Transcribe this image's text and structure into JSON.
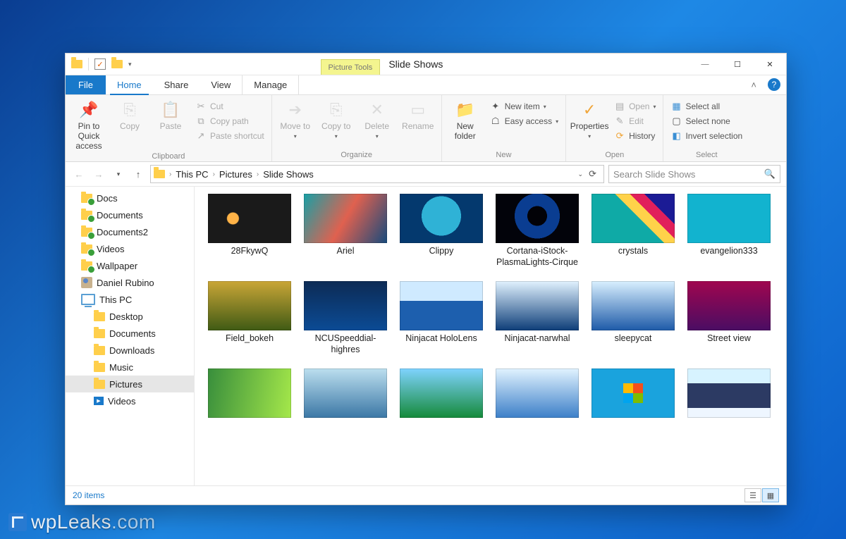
{
  "titlebar": {
    "context_tab": "Picture Tools",
    "title": "Slide Shows",
    "min": "—",
    "max": "☐",
    "close": "✕"
  },
  "tabs": {
    "file": "File",
    "home": "Home",
    "share": "Share",
    "view": "View",
    "manage": "Manage"
  },
  "ribbon": {
    "clipboard": {
      "label": "Clipboard",
      "pin": "Pin to Quick access",
      "copy": "Copy",
      "paste": "Paste",
      "cut": "Cut",
      "copy_path": "Copy path",
      "paste_shortcut": "Paste shortcut"
    },
    "organize": {
      "label": "Organize",
      "move_to": "Move to",
      "copy_to": "Copy to",
      "delete": "Delete",
      "rename": "Rename"
    },
    "new": {
      "label": "New",
      "new_folder": "New folder",
      "new_item": "New item",
      "easy_access": "Easy access"
    },
    "open": {
      "label": "Open",
      "properties": "Properties",
      "open": "Open",
      "edit": "Edit",
      "history": "History"
    },
    "select": {
      "label": "Select",
      "select_all": "Select all",
      "select_none": "Select none",
      "invert": "Invert selection"
    }
  },
  "address": {
    "crumbs": [
      "This PC",
      "Pictures",
      "Slide Shows"
    ],
    "search_placeholder": "Search Slide Shows"
  },
  "sidebar": {
    "items": [
      {
        "kind": "folder",
        "sync": true,
        "lvl": 1,
        "label": "Docs"
      },
      {
        "kind": "folder",
        "sync": true,
        "lvl": 1,
        "label": "Documents"
      },
      {
        "kind": "folder",
        "sync": true,
        "lvl": 1,
        "label": "Documents2"
      },
      {
        "kind": "folder",
        "sync": true,
        "lvl": 1,
        "label": "Videos"
      },
      {
        "kind": "folder",
        "sync": true,
        "lvl": 1,
        "label": "Wallpaper"
      },
      {
        "kind": "user",
        "sync": false,
        "lvl": 1,
        "label": "Daniel Rubino"
      },
      {
        "kind": "pc",
        "sync": false,
        "lvl": 1,
        "label": "This PC"
      },
      {
        "kind": "folder",
        "sync": false,
        "lvl": 2,
        "label": "Desktop"
      },
      {
        "kind": "folder",
        "sync": false,
        "lvl": 2,
        "label": "Documents"
      },
      {
        "kind": "folder",
        "sync": false,
        "lvl": 2,
        "label": "Downloads"
      },
      {
        "kind": "folder",
        "sync": false,
        "lvl": 2,
        "label": "Music"
      },
      {
        "kind": "folder",
        "sync": false,
        "lvl": 2,
        "label": "Pictures",
        "selected": true
      },
      {
        "kind": "video",
        "sync": false,
        "lvl": 2,
        "label": "Videos"
      }
    ]
  },
  "files": [
    {
      "name": "28FkywQ",
      "bg": "linear-gradient(#1a1a1a,#1a1a1a)",
      "overlay": "radial-gradient(circle at 30% 50%, #ffb347 0 8px, transparent 9px)"
    },
    {
      "name": "Ariel",
      "bg": "linear-gradient(120deg,#17a0a6,#e0614f,#174a7c)"
    },
    {
      "name": "Clippy",
      "bg": "radial-gradient(circle at 50% 45%, #2fb2d6 0 28px, #04396e 28px)"
    },
    {
      "name": "Cortana-iStock-PlasmaLights-Cirque",
      "bg": "radial-gradient(circle at 50% 45%, #020207 0 14px, #0a3d91 14px 32px, #02030a 32px)"
    },
    {
      "name": "crystals",
      "bg": "linear-gradient(#0faaa6,#0faaa6)",
      "overlay": "linear-gradient(45deg,transparent 55%, #ffd24a 55% 66%, #e11f5b 66% 77%, #1b1b95 77%)"
    },
    {
      "name": "evangelion333",
      "bg": "linear-gradient(#12b3cf,#12b3cf)"
    },
    {
      "name": "Field_bokeh",
      "bg": "linear-gradient(#caa637,#3f5a14)"
    },
    {
      "name": "NCUSpeeddial-highres",
      "bg": "linear-gradient(#0d2b55,#0b4b95)"
    },
    {
      "name": "Ninjacat HoloLens",
      "bg": "linear-gradient(180deg,#cfeaff 0 40%, #1d5fae 40%)"
    },
    {
      "name": "Ninjacat-narwhal",
      "bg": "linear-gradient(180deg,#e1f2ff,#0d3d78)"
    },
    {
      "name": "sleepycat",
      "bg": "linear-gradient(180deg,#d9f0ff,#1d5aa8)"
    },
    {
      "name": "Street view",
      "bg": "linear-gradient(#a0064f,#4a0d63)"
    },
    {
      "name": "",
      "bg": "linear-gradient(100deg,#388e3c,#a5e84a)"
    },
    {
      "name": "",
      "bg": "linear-gradient(#bcdfef,#3b77a5)"
    },
    {
      "name": "",
      "bg": "linear-gradient(#7fd3ff,#158a3a)"
    },
    {
      "name": "",
      "bg": "linear-gradient(#e1f3ff,#3c7fc8)"
    },
    {
      "name": "",
      "bg": "linear-gradient(#1aa3dd,#1aa3dd)",
      "overlay": "conic-gradient(from 0deg at 50% 50%, #f34f1c 0 90deg, #7fbc00 90deg 180deg, #00a4ef 180deg 270deg, #ffba01 270deg)"
    },
    {
      "name": "",
      "bg": "linear-gradient(#d7f3ff 0 30%, #2c3a63 30% 80%, #eef6ff 80%)"
    }
  ],
  "status": {
    "items": "20 items"
  },
  "watermark": {
    "a": "wpLeaks",
    "b": ".com"
  }
}
